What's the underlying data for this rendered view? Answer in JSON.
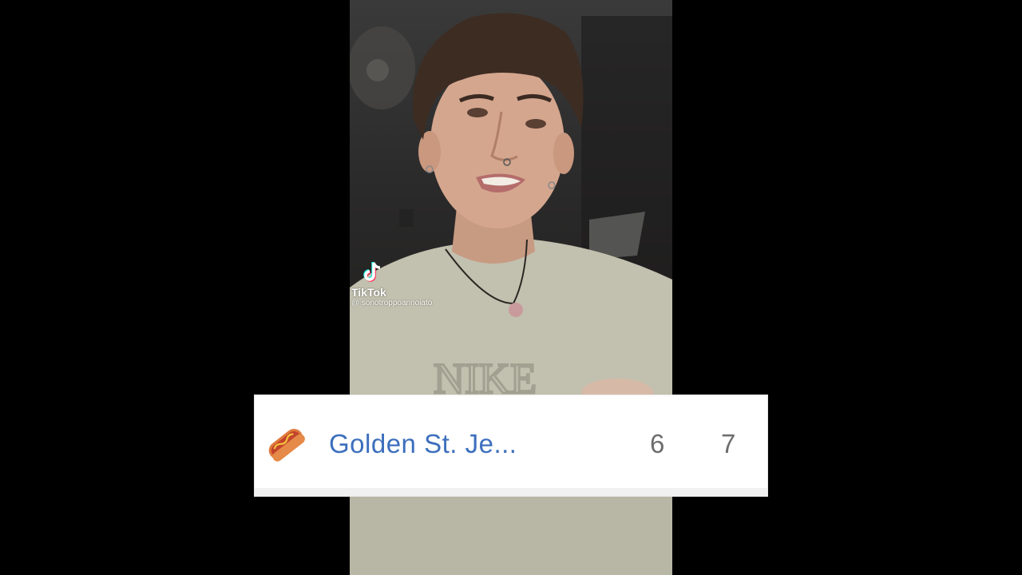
{
  "watermark": {
    "brand": "TikTok",
    "handle": "@ sonotroppoannoiato",
    "icon": "tiktok-note-icon"
  },
  "score_row": {
    "team_name": "Golden St. Je...",
    "team_icon": "hot-dog-icon",
    "scores": [
      "6",
      "7"
    ],
    "team_color": "#3c6fbd",
    "score_color": "#6d6d6d"
  }
}
